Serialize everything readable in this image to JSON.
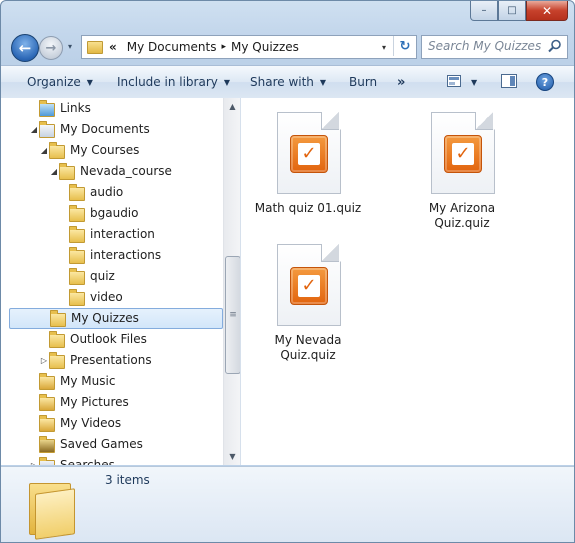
{
  "window": {
    "caption_min": "–",
    "caption_max": "□",
    "caption_close": "✕"
  },
  "nav": {
    "back_glyph": "←",
    "forward_glyph": "→",
    "recent_glyph": "▾",
    "breadcrumb": {
      "overflow": "«",
      "items": [
        "My Documents",
        "My Quizzes"
      ],
      "separator": "▸"
    },
    "dropdown_glyph": "▾",
    "refresh_glyph": "↻",
    "search_placeholder": "Search My Quizzes"
  },
  "toolbar": {
    "organize": "Organize",
    "include_in_library": "Include in library",
    "share_with": "Share with",
    "burn": "Burn",
    "more": "»",
    "help": "?"
  },
  "tree": {
    "items": [
      {
        "label": "Links",
        "expander": "",
        "icon": "links-folder-icon"
      },
      {
        "label": "My Documents",
        "expander": "◢",
        "icon": "documents-icon"
      },
      {
        "label": "My Courses",
        "expander": "◢",
        "icon": "folder-icon"
      },
      {
        "label": "Nevada_course",
        "expander": "◢",
        "icon": "folder-icon"
      },
      {
        "label": "audio",
        "expander": "",
        "icon": "folder-icon"
      },
      {
        "label": "bgaudio",
        "expander": "",
        "icon": "folder-icon"
      },
      {
        "label": "interaction",
        "expander": "",
        "icon": "folder-icon"
      },
      {
        "label": "interactions",
        "expander": "",
        "icon": "folder-icon"
      },
      {
        "label": "quiz",
        "expander": "",
        "icon": "folder-icon"
      },
      {
        "label": "video",
        "expander": "",
        "icon": "folder-icon"
      },
      {
        "label": "My Quizzes",
        "expander": "",
        "icon": "folder-icon",
        "selected": true
      },
      {
        "label": "Outlook Files",
        "expander": "",
        "icon": "folder-icon"
      },
      {
        "label": "Presentations",
        "expander": "▷",
        "icon": "folder-icon"
      },
      {
        "label": "My Music",
        "expander": "",
        "icon": "music-folder-icon"
      },
      {
        "label": "My Pictures",
        "expander": "",
        "icon": "pictures-folder-icon"
      },
      {
        "label": "My Videos",
        "expander": "",
        "icon": "videos-folder-icon"
      },
      {
        "label": "Saved Games",
        "expander": "",
        "icon": "saved-games-icon"
      },
      {
        "label": "Searches",
        "expander": "▷",
        "icon": "searches-icon"
      }
    ],
    "scroll_up": "▲",
    "scroll_down": "▼",
    "scroll_grip": "≡"
  },
  "files": [
    {
      "name": "Math quiz 01.quiz"
    },
    {
      "name": "My Arizona Quiz.quiz"
    },
    {
      "name": "My Nevada Quiz.quiz"
    }
  ],
  "file_badge_glyph": "✓",
  "status": {
    "item_count": "3 items"
  },
  "colors": {
    "accent": "#e2640e",
    "selection": "#d2e6fa",
    "command_text": "#1e395b"
  }
}
